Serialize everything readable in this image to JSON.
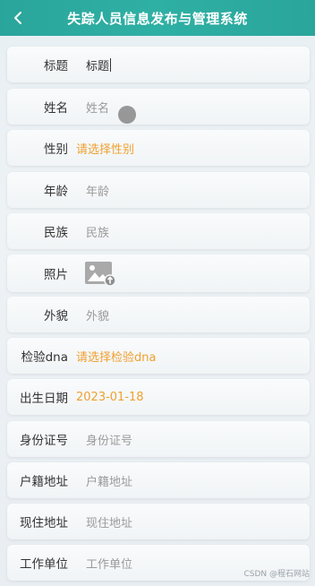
{
  "header": {
    "title": "失踪人员信息发布与管理系统",
    "back_icon": "chevron-left-icon"
  },
  "colors": {
    "header_bg": "#2aa59b",
    "accent_orange": "#f0a030",
    "placeholder": "#9a9a9a"
  },
  "form": {
    "title": {
      "label": "标题",
      "value": "标题"
    },
    "name": {
      "label": "姓名",
      "placeholder": "姓名"
    },
    "gender": {
      "label": "性别",
      "select_text": "请选择性别"
    },
    "age": {
      "label": "年龄",
      "placeholder": "年龄"
    },
    "ethnicity": {
      "label": "民族",
      "placeholder": "民族"
    },
    "photo": {
      "label": "照片",
      "icon": "add-image-icon"
    },
    "appearance": {
      "label": "外貌",
      "placeholder": "外貌"
    },
    "dna": {
      "label": "检验dna",
      "select_text": "请选择检验dna"
    },
    "birthdate": {
      "label": "出生日期",
      "value": "2023-01-18"
    },
    "id_number": {
      "label": "身份证号",
      "placeholder": "身份证号"
    },
    "household_address": {
      "label": "户籍地址",
      "placeholder": "户籍地址"
    },
    "current_address": {
      "label": "现住地址",
      "placeholder": "现住地址"
    },
    "work_unit": {
      "label": "工作单位",
      "placeholder": "工作单位"
    }
  },
  "watermark": "CSDN @程石网站"
}
